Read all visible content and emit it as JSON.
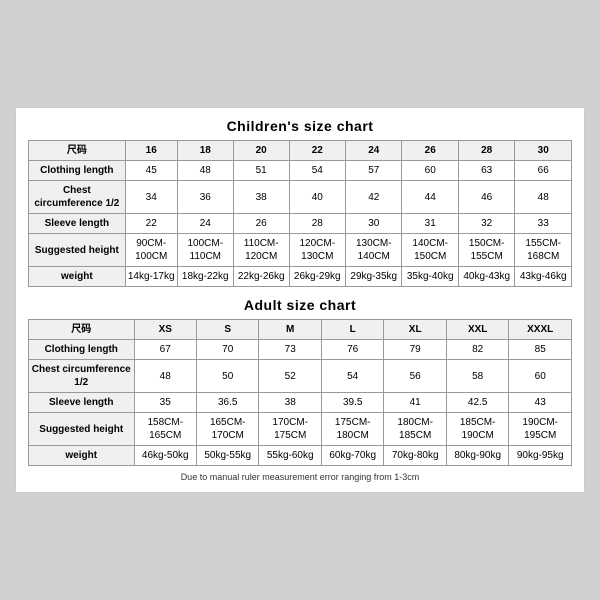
{
  "children_chart": {
    "title": "Children's size chart",
    "columns": [
      "尺码",
      "16",
      "18",
      "20",
      "22",
      "24",
      "26",
      "28",
      "30"
    ],
    "rows": [
      {
        "label": "Clothing length",
        "values": [
          "45",
          "48",
          "51",
          "54",
          "57",
          "60",
          "63",
          "66"
        ]
      },
      {
        "label": "Chest circumference 1/2",
        "values": [
          "34",
          "36",
          "38",
          "40",
          "42",
          "44",
          "46",
          "48"
        ]
      },
      {
        "label": "Sleeve length",
        "values": [
          "22",
          "24",
          "26",
          "28",
          "30",
          "31",
          "32",
          "33"
        ]
      },
      {
        "label": "Suggested height",
        "values": [
          "90CM-100CM",
          "100CM-110CM",
          "110CM-120CM",
          "120CM-130CM",
          "130CM-140CM",
          "140CM-150CM",
          "150CM-155CM",
          "155CM-168CM"
        ]
      },
      {
        "label": "weight",
        "values": [
          "14kg-17kg",
          "18kg-22kg",
          "22kg-26kg",
          "26kg-29kg",
          "29kg-35kg",
          "35kg-40kg",
          "40kg-43kg",
          "43kg-46kg"
        ]
      }
    ]
  },
  "adult_chart": {
    "title": "Adult size chart",
    "columns": [
      "尺码",
      "XS",
      "S",
      "M",
      "L",
      "XL",
      "XXL",
      "XXXL"
    ],
    "rows": [
      {
        "label": "Clothing length",
        "values": [
          "67",
          "70",
          "73",
          "76",
          "79",
          "82",
          "85"
        ]
      },
      {
        "label": "Chest circumference 1/2",
        "values": [
          "48",
          "50",
          "52",
          "54",
          "56",
          "58",
          "60"
        ]
      },
      {
        "label": "Sleeve length",
        "values": [
          "35",
          "36.5",
          "38",
          "39.5",
          "41",
          "42.5",
          "43"
        ]
      },
      {
        "label": "Suggested height",
        "values": [
          "158CM-165CM",
          "165CM-170CM",
          "170CM-175CM",
          "175CM-180CM",
          "180CM-185CM",
          "185CM-190CM",
          "190CM-195CM"
        ]
      },
      {
        "label": "weight",
        "values": [
          "46kg-50kg",
          "50kg-55kg",
          "55kg-60kg",
          "60kg-70kg",
          "70kg-80kg",
          "80kg-90kg",
          "90kg-95kg"
        ]
      }
    ]
  },
  "footnote": "Due to manual ruler measurement error ranging from 1-3cm"
}
